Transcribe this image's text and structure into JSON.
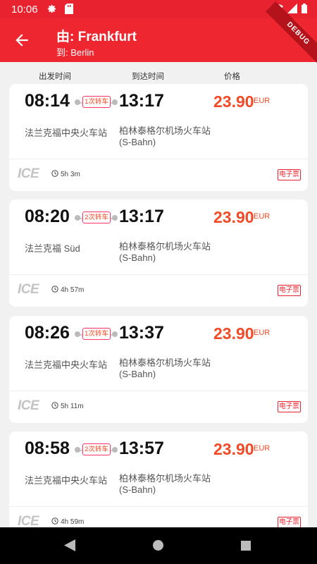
{
  "status_bar": {
    "time": "10:06"
  },
  "app_bar": {
    "from": "由: Frankfurt",
    "to": "到: Berlin",
    "debug": "DEBUG"
  },
  "columns": {
    "departure": "出发时间",
    "arrival": "到达时间",
    "price": "价格"
  },
  "trips": [
    {
      "dep": "08:14",
      "arr": "13:17",
      "transfer": "1次转车",
      "price": "23.90",
      "currency": "EUR",
      "from": "法兰克福中央火车站",
      "to": "柏林泰格尔机场火车站\n(S-Bahn)",
      "train": "ICE",
      "duration": "5h 3m",
      "ticket": "电子票"
    },
    {
      "dep": "08:20",
      "arr": "13:17",
      "transfer": "2次转车",
      "price": "23.90",
      "currency": "EUR",
      "from": "法兰克福 Süd",
      "to": "柏林泰格尔机场火车站\n(S-Bahn)",
      "train": "ICE",
      "duration": "4h 57m",
      "ticket": "电子票"
    },
    {
      "dep": "08:26",
      "arr": "13:37",
      "transfer": "1次转车",
      "price": "23.90",
      "currency": "EUR",
      "from": "法兰克福中央火车站",
      "to": "柏林泰格尔机场火车站\n(S-Bahn)",
      "train": "ICE",
      "duration": "5h 11m",
      "ticket": "电子票"
    },
    {
      "dep": "08:58",
      "arr": "13:57",
      "transfer": "2次转车",
      "price": "23.90",
      "currency": "EUR",
      "from": "法兰克福中央火车站",
      "to": "柏林泰格尔机场火车站\n(S-Bahn)",
      "train": "ICE",
      "duration": "4h 59m",
      "ticket": "电子票"
    }
  ],
  "colors": {
    "brand": "#ee2630",
    "price": "#f04a27"
  }
}
